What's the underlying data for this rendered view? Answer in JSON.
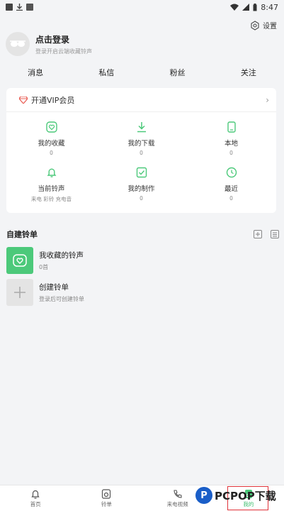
{
  "status_bar": {
    "time": "8:47"
  },
  "header": {
    "settings_label": "设置",
    "login_title": "点击登录",
    "login_sub": "登录开启云端收藏铃声"
  },
  "stats": [
    "消息",
    "私信",
    "粉丝",
    "关注"
  ],
  "vip": {
    "label": "开通VIP会员"
  },
  "grid": [
    {
      "label": "我的收藏",
      "sub": "0",
      "icon": "heart-icon"
    },
    {
      "label": "我的下载",
      "sub": "0",
      "icon": "download-icon"
    },
    {
      "label": "本地",
      "sub": "0",
      "icon": "phone-icon"
    },
    {
      "label": "当前铃声",
      "sub": "来电 彩铃 充电音",
      "icon": "bell-icon"
    },
    {
      "label": "我的制作",
      "sub": "0",
      "icon": "check-box-icon"
    },
    {
      "label": "最近",
      "sub": "0",
      "icon": "clock-icon"
    }
  ],
  "playlists": {
    "title": "自建铃单",
    "items": [
      {
        "name": "我收藏的铃声",
        "sub": "0首"
      },
      {
        "name": "创建铃单",
        "sub": "登录后可创建铃单"
      }
    ]
  },
  "bottom_nav": [
    {
      "label": "首页",
      "icon": "bell-outline-icon"
    },
    {
      "label": "铃单",
      "icon": "speaker-icon"
    },
    {
      "label": "来电视频",
      "icon": "phone-video-icon"
    },
    {
      "label": "我的",
      "icon": "user-icon"
    }
  ],
  "watermark": "PCPOP下载",
  "colors": {
    "accent_green": "#4cc97a",
    "vip_red": "#e8584f",
    "active_box": "#e0333a"
  }
}
